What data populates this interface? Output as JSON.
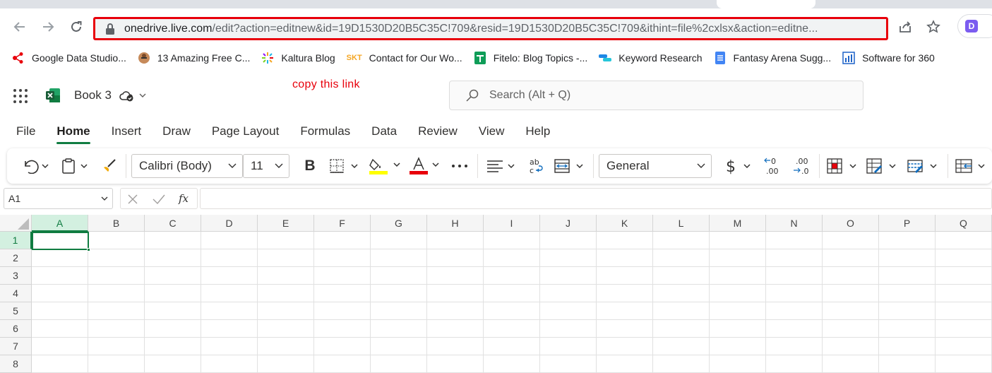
{
  "browser": {
    "url_host": "onedrive.live.com",
    "url_path": "/edit?action=editnew&id=19D1530D20B5C35C!709&resid=19D1530D20B5C35C!709&ithint=file%2cxlsx&action=editne...",
    "bookmarks": [
      {
        "label": "Google Data Studio...",
        "icon": "data-studio-icon"
      },
      {
        "label": "13 Amazing Free C...",
        "icon": "avatar-icon"
      },
      {
        "label": "Kaltura Blog",
        "icon": "kaltura-icon"
      },
      {
        "label": "Contact for Our Wo...",
        "icon": "skt-icon"
      },
      {
        "label": "Fitelo: Blog Topics -...",
        "icon": "sheets-icon"
      },
      {
        "label": "Keyword Research",
        "icon": "keyword-icon"
      },
      {
        "label": "Fantasy Arena Sugg...",
        "icon": "docs-icon"
      },
      {
        "label": "Software for 360",
        "icon": "chart-icon"
      }
    ]
  },
  "annotation": "copy this link",
  "excel": {
    "title": "Book 3",
    "search_placeholder": "Search (Alt + Q)",
    "tabs": [
      "File",
      "Home",
      "Insert",
      "Draw",
      "Page Layout",
      "Formulas",
      "Data",
      "Review",
      "View",
      "Help"
    ],
    "active_tab": "Home",
    "font_name": "Calibri (Body)",
    "font_size": "11",
    "number_format": "General",
    "name_box": "A1",
    "fx_label": "fx",
    "columns": [
      "A",
      "B",
      "C",
      "D",
      "E",
      "F",
      "G",
      "H",
      "I",
      "J",
      "K",
      "L",
      "M",
      "N",
      "O",
      "P",
      "Q"
    ],
    "rows": [
      "1",
      "2",
      "3",
      "4",
      "5",
      "6",
      "7",
      "8"
    ],
    "accent": "#107c41",
    "highlight_color": "#ffff00",
    "font_color": "#e8000b"
  }
}
